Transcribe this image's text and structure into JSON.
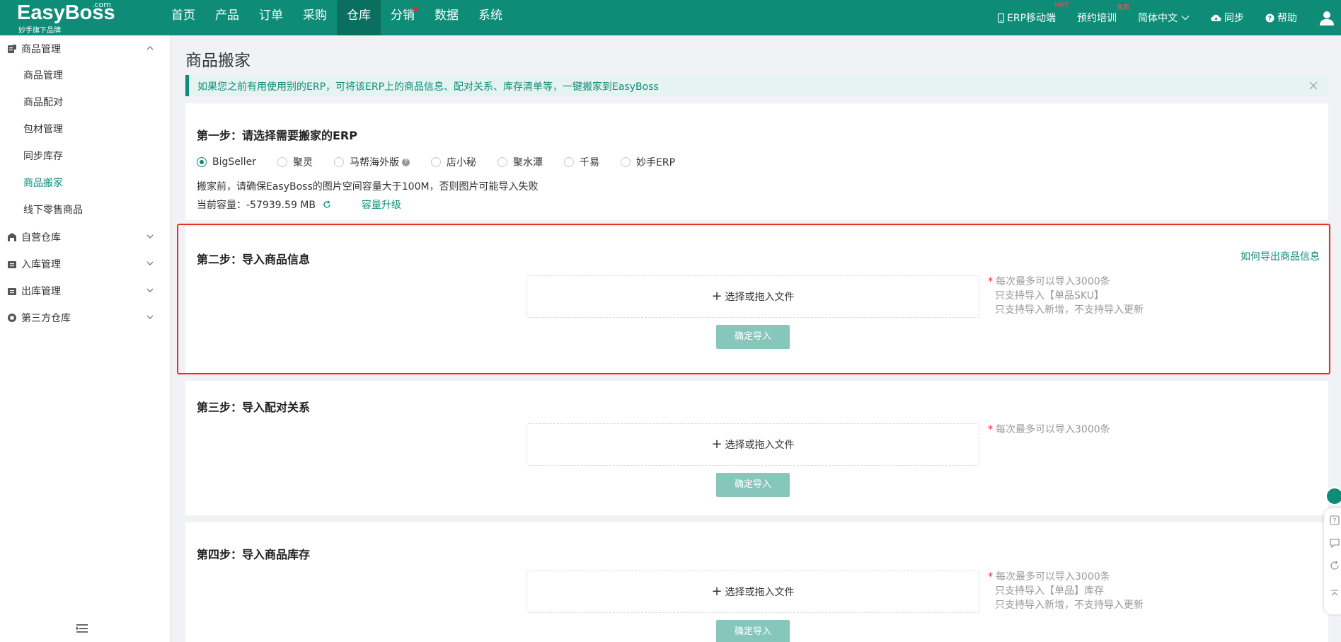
{
  "brand": {
    "name": "EasyBoss",
    "com": ".com",
    "tagline": "妙手旗下品牌"
  },
  "nav": [
    {
      "label": "首页",
      "active": false,
      "dot": false
    },
    {
      "label": "产品",
      "active": false,
      "dot": false
    },
    {
      "label": "订单",
      "active": false,
      "dot": false
    },
    {
      "label": "采购",
      "active": false,
      "dot": false
    },
    {
      "label": "仓库",
      "active": true,
      "dot": false
    },
    {
      "label": "分销",
      "active": false,
      "dot": true
    },
    {
      "label": "数据",
      "active": false,
      "dot": false
    },
    {
      "label": "系统",
      "active": false,
      "dot": false
    }
  ],
  "top_right": {
    "mobile": "ERP移动端",
    "mobile_badge": "HOT",
    "training": "预约培训",
    "training_badge": "免费",
    "language": "简体中文",
    "sync": "同步",
    "help": "帮助"
  },
  "sidebar": {
    "group_goods": "商品管理",
    "items": [
      "商品管理",
      "商品配对",
      "包材管理",
      "同步库存",
      "商品搬家",
      "线下零售商品"
    ],
    "active_index": 4,
    "group_own": "自营仓库",
    "group_in": "入库管理",
    "group_out": "出库管理",
    "group_third": "第三方仓库"
  },
  "page": {
    "title": "商品搬家",
    "alert": "如果您之前有用使用别的ERP，可将该ERP上的商品信息、配对关系、库存清单等，一键搬家到EasyBoss"
  },
  "step1": {
    "title": "第一步：请选择需要搬家的ERP",
    "options": [
      "BigSeller",
      "聚灵",
      "马帮海外版",
      "店小秘",
      "聚水潭",
      "千易",
      "妙手ERP"
    ],
    "selected": "BigSeller",
    "note": "搬家前，请确保EasyBoss的图片空间容量大于100M，否则图片可能导入失败",
    "capacity_label": "当前容量：",
    "capacity_value": "-57939.59 MB",
    "upgrade": "容量升级"
  },
  "step2": {
    "title": "第二步：导入商品信息",
    "how_link": "如何导出商品信息",
    "dropzone": "选择或拖入文件",
    "confirm": "确定导入",
    "hint1": "每次最多可以导入3000条",
    "hint2": "只支持导入【单品SKU】",
    "hint3": "只支持导入新增，不支持导入更新"
  },
  "step3": {
    "title": "第三步：导入配对关系",
    "dropzone": "选择或拖入文件",
    "confirm": "确定导入",
    "hint1": "每次最多可以导入3000条"
  },
  "step4": {
    "title": "第四步：导入商品库存",
    "dropzone": "选择或拖入文件",
    "confirm": "确定导入",
    "hint1": "每次最多可以导入3000条",
    "hint2": "只支持导入【单品】库存",
    "hint3": "只支持导入新增，不支持导入更新"
  },
  "colors": {
    "brand": "#0e8c78",
    "highlight": "#e8321e",
    "button_disabled": "#86c6bb"
  }
}
